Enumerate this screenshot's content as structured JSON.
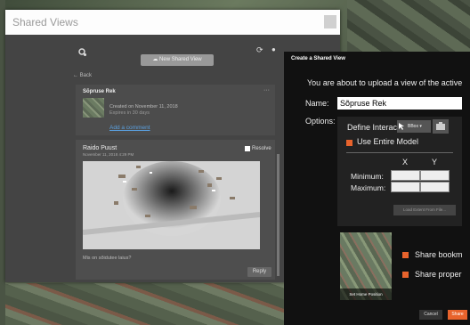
{
  "shared_views": {
    "title": "Shared Views",
    "new_button": "New Shared View",
    "back": "Back",
    "item": {
      "title": "Sõpruse Rek",
      "more": "···",
      "created": "Created on November 11, 2018",
      "expires": "Expires in 30 days",
      "add_comment": "Add a comment"
    },
    "comment": {
      "author": "Raido Puust",
      "date": "November 11, 2018 4:29 PM",
      "resolve": "Resolve",
      "text": "Mis on sõidutee laius?",
      "reply": "Reply"
    }
  },
  "create_dialog": {
    "title": "Create a Shared View",
    "intro": "You are about to upload a view of the active",
    "name_label": "Name:",
    "name_value": "Sõpruse Rek",
    "options_label": "Options:",
    "define_label": "Define Interac",
    "bbox_label": "BBox",
    "use_entire_model": "Use Entire Model",
    "col_x": "X",
    "col_y": "Y",
    "minimum": "Minimum:",
    "maximum": "Maximum:",
    "load_extent": "Load Extent From File...",
    "set_home": "Set Home Position",
    "share_bookmarks": "Share bookm",
    "share_properties": "Share proper",
    "cancel": "Cancel",
    "share": "Share"
  },
  "icons": {
    "accent": "#e8632c"
  }
}
